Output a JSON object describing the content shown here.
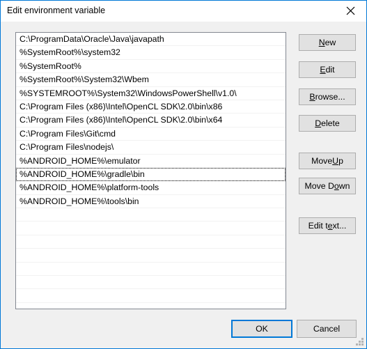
{
  "window": {
    "title": "Edit environment variable",
    "close_icon": "close-icon",
    "border_color": "#0078d7",
    "titlebar_bg": "#ffffff",
    "client_bg": "#f0f0f0"
  },
  "list": {
    "focused_index": 10,
    "items": [
      "C:\\ProgramData\\Oracle\\Java\\javapath",
      "%SystemRoot%\\system32",
      "%SystemRoot%",
      "%SystemRoot%\\System32\\Wbem",
      "%SYSTEMROOT%\\System32\\WindowsPowerShell\\v1.0\\",
      "C:\\Program Files (x86)\\Intel\\OpenCL SDK\\2.0\\bin\\x86",
      "C:\\Program Files (x86)\\Intel\\OpenCL SDK\\2.0\\bin\\x64",
      "C:\\Program Files\\Git\\cmd",
      "C:\\Program Files\\nodejs\\",
      "%ANDROID_HOME%\\emulator",
      "%ANDROID_HOME%\\gradle\\bin",
      "%ANDROID_HOME%\\platform-tools",
      "%ANDROID_HOME%\\tools\\bin"
    ],
    "empty_row_count": 7,
    "background": "#ffffff",
    "border_color": "#828790",
    "separator_color": "#f2f2f2"
  },
  "side_buttons": [
    {
      "id": "new",
      "prefix": "",
      "accel": "N",
      "suffix": "ew"
    },
    {
      "id": "edit",
      "prefix": "",
      "accel": "E",
      "suffix": "dit"
    },
    {
      "id": "browse",
      "prefix": "",
      "accel": "B",
      "suffix": "rowse..."
    },
    {
      "id": "delete",
      "prefix": "",
      "accel": "D",
      "suffix": "elete"
    },
    {
      "id": "move_up",
      "prefix": "Move ",
      "accel": "U",
      "suffix": "p"
    },
    {
      "id": "move_down",
      "prefix": "Move D",
      "accel": "o",
      "suffix": "wn"
    },
    {
      "id": "edit_text",
      "prefix": "Edit t",
      "accel": "e",
      "suffix": "xt..."
    }
  ],
  "footer": {
    "ok_label": "OK",
    "cancel_label": "Cancel",
    "ok_is_default": true,
    "default_focus_color": "#0078d7",
    "resize_grip": "resize-grip-icon"
  }
}
